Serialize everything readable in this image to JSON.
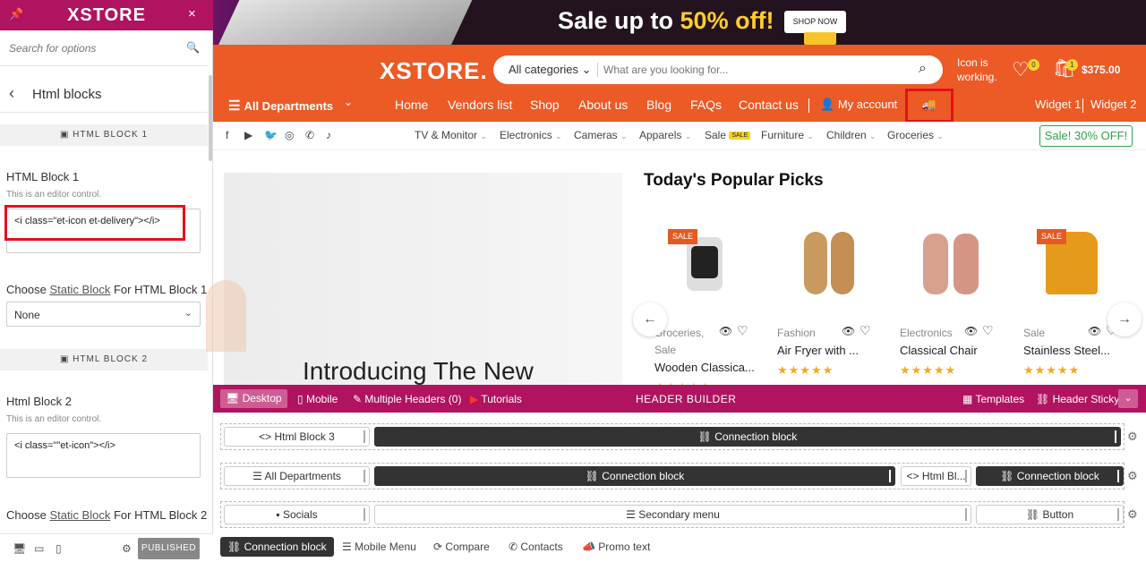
{
  "sidebar": {
    "logo": "XSTORE",
    "pin_icon": "pin-icon",
    "close_icon": "×",
    "search_placeholder": "Search for options",
    "back_title": "Html blocks",
    "section1": "HTML BLOCK 1",
    "block1_label": "HTML Block 1",
    "block1_note": "This is an editor control.",
    "block1_value": "<i class=\"et-icon et-delivery\"></i>",
    "choose1_prefix": "Choose",
    "choose1_link": "Static Block",
    "choose1_suffix": "For HTML Block 1",
    "select1_value": "None",
    "section2": "HTML BLOCK 2",
    "block2_label": "Html Block 2",
    "block2_note": "This is an editor control.",
    "block2_value": "<i class=\"\"et-icon\"></i>",
    "choose2_prefix": "Choose",
    "choose2_link": "Static Block",
    "choose2_suffix": "For HTML Block 2",
    "publish": "PUBLISHED"
  },
  "banner": {
    "sale_prefix": "Sale up to ",
    "sale_highlight": "50% off!",
    "shop_now": "SHOP NOW"
  },
  "header": {
    "logo": "XSTORE.",
    "category": "All categories",
    "search_placeholder": "What are you looking for...",
    "status_line1": "Icon is",
    "status_line2": "working.",
    "wishlist_count": "0",
    "cart_count": "1",
    "cart_total": "$375.00",
    "departments": "All Departments",
    "nav": [
      "Home",
      "Vendors list",
      "Shop",
      "About us",
      "Blog",
      "FAQs",
      "Contact us"
    ],
    "my_account": "My account",
    "widget1": "Widget 1",
    "widget2": "Widget 2"
  },
  "subnav": {
    "items": [
      "TV & Monitor",
      "Electronics",
      "Cameras",
      "Apparels",
      "Sale",
      "Furniture",
      "Children",
      "Groceries"
    ],
    "sale_badge": "SALE",
    "sale_off": "Sale! 30% OFF!"
  },
  "hero": {
    "title": "Introducing The New"
  },
  "picks": {
    "title": "Today's Popular Picks",
    "sale_tag": "SALE",
    "products": [
      {
        "cat": "Groceries,",
        "cat2": "Sale",
        "name": "Wooden Classica...",
        "stars": "★★★★★"
      },
      {
        "cat": "Fashion",
        "cat2": "",
        "name": "Air Fryer with ...",
        "stars": "★★★★★"
      },
      {
        "cat": "Electronics",
        "cat2": "",
        "name": "Classical Chair",
        "stars": "★★★★★"
      },
      {
        "cat": "Sale",
        "cat2": "",
        "name": "Stainless Steel...",
        "stars": "★★★★★"
      }
    ]
  },
  "builder": {
    "desktop": "Desktop",
    "mobile": "Mobile",
    "multiple": "Multiple Headers (0)",
    "tutorials": "Tutorials",
    "title": "HEADER BUILDER",
    "templates": "Templates",
    "sticky": "Header Sticky",
    "row1": {
      "html3": "<> Html Block 3",
      "conn": "Connection block"
    },
    "row2": {
      "dept": "All Departments",
      "conn1": "Connection block",
      "html": "<> Html Bl...",
      "conn2": "Connection block"
    },
    "row3": {
      "socials": "Socials",
      "secondary": "Secondary menu",
      "button": "Button"
    },
    "bottom": [
      "Connection block",
      "Mobile Menu",
      "Compare",
      "Contacts",
      "Promo text"
    ]
  }
}
